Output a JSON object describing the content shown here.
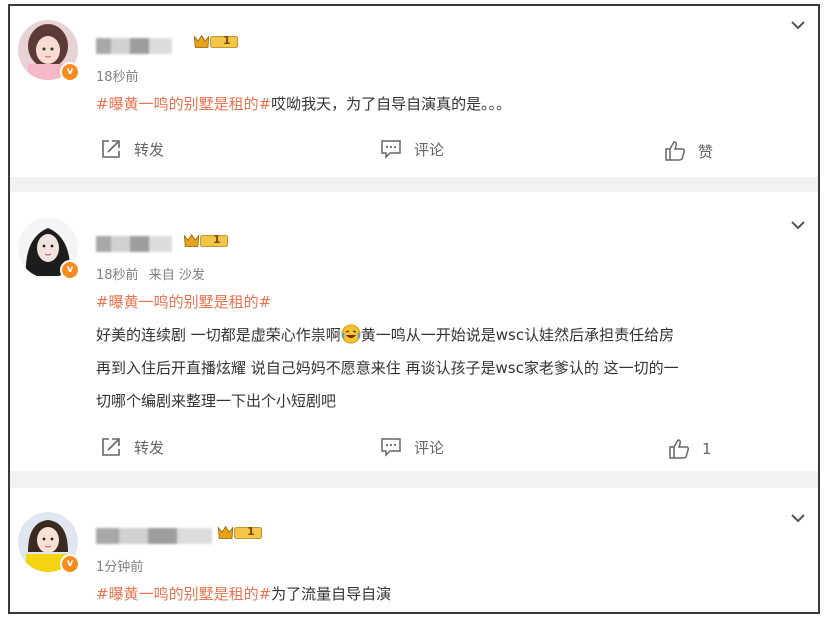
{
  "comments": [
    {
      "username_blurred": true,
      "level": "1",
      "time": "18秒前",
      "source": "",
      "hashtag": "#曝黄一鸣的别墅是租的#",
      "text": "哎呦我天，为了自导自演真的是。。。",
      "repost_label": "转发",
      "comment_label": "评论",
      "like_label": "赞"
    },
    {
      "username_blurred": true,
      "level": "1",
      "time": "18秒前",
      "source": "来自 沙发",
      "hashtag": "#曝黄一鸣的别墅是租的#",
      "text_line1a": "好美的连续剧 一切都是虚荣心作祟啊",
      "text_line1b": "黄一鸣从一开始说是wsc认娃然后承担责任给房",
      "text_line2": "再到入住后开直播炫耀 说自己妈妈不愿意来住 再谈认孩子是wsc家老爹认的 这一切的一",
      "text_line3": "切哪个编剧来整理一下出个小短剧吧",
      "repost_label": "转发",
      "comment_label": "评论",
      "like_label": "1"
    },
    {
      "username_blurred": true,
      "level": "1",
      "time": "1分钟前",
      "source": "",
      "hashtag": "#曝黄一鸣的别墅是租的#",
      "text": "为了流量自导自演"
    }
  ],
  "icons": {
    "verified": "v",
    "more": "chevron-down-icon",
    "repost": "share-icon",
    "comment": "comment-icon",
    "like": "thumbs-up-icon",
    "emoji": "laughing-crying-emoji"
  },
  "colors": {
    "hashtag": "#eb7350",
    "verified_badge": "#f78b1f",
    "meta_text": "#808080",
    "body_text": "#333333"
  }
}
